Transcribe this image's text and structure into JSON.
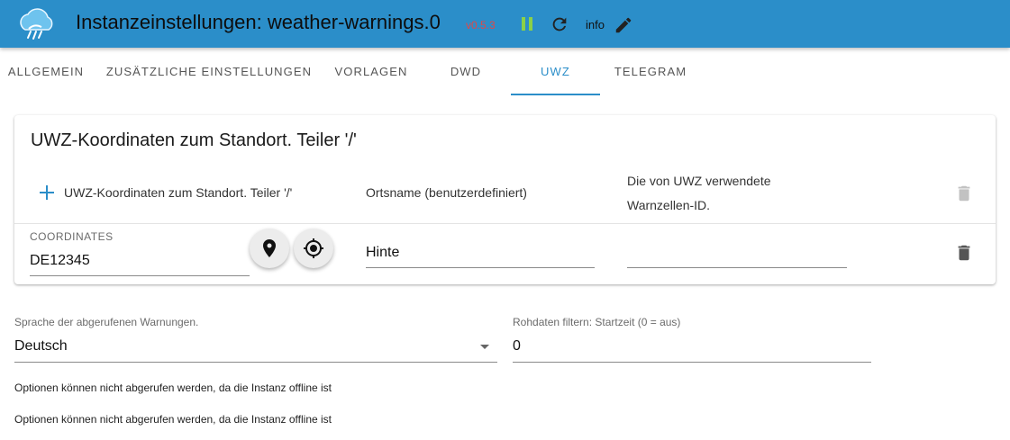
{
  "header": {
    "title": "Instanzeinstellungen: weather-warnings.0",
    "version": "v0.5.3",
    "info_label": "info",
    "icons": [
      "weather-cloud-logo-icon",
      "pause-icon",
      "refresh-icon",
      "edit-icon"
    ],
    "colors": {
      "background": "#2b8ec9",
      "version": "#e04848",
      "pause": "#8bd148"
    }
  },
  "tabs": [
    {
      "label": "ALLGEMEIN",
      "active": false
    },
    {
      "label": "ZUSÄTZLICHE EINSTELLUNGEN",
      "active": false
    },
    {
      "label": "VORLAGEN",
      "active": false
    },
    {
      "label": "DWD",
      "active": false
    },
    {
      "label": "UWZ",
      "active": true
    },
    {
      "label": "TELEGRAM",
      "active": false
    }
  ],
  "card": {
    "title": "UWZ-Koordinaten zum Standort. Teiler '/'",
    "columns": {
      "coords": "UWZ-Koordinaten zum Standort. Teiler '/'",
      "name": "Ortsname (benutzerdefiniert)",
      "warncell_line1": "Die von UWZ verwendete",
      "warncell_line2": "Warnzellen-ID."
    },
    "row": {
      "coords_label": "COORDINATES",
      "coords_value": "DE12345",
      "name_value": "Hinte",
      "warncell_value": ""
    }
  },
  "language": {
    "label": "Sprache der abgerufenen Warnungen.",
    "value": "Deutsch"
  },
  "raw_filter": {
    "label": "Rohdaten filtern: Startzeit (0 = aus)",
    "value": "0"
  },
  "messages": [
    "Optionen können nicht abgerufen werden, da die Instanz offline ist",
    "Optionen können nicht abgerufen werden, da die Instanz offline ist"
  ]
}
